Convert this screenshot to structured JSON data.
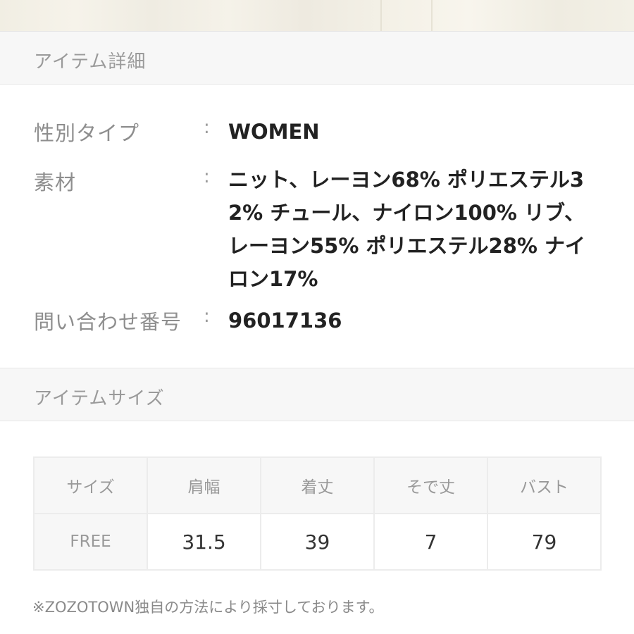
{
  "item_details": {
    "header": "アイテム詳細",
    "rows": [
      {
        "label": "性別タイプ",
        "colon": ":",
        "value": "WOMEN"
      },
      {
        "label": "素材",
        "colon": ":",
        "value": "ニット、レーヨン68% ポリエステル32% チュール、ナイロン100% リブ、レーヨン55% ポリエステル28% ナイロン17%"
      },
      {
        "label": "問い合わせ番号",
        "colon": ":",
        "value": "96017136"
      }
    ]
  },
  "item_size": {
    "header": "アイテムサイズ",
    "columns": [
      "サイズ",
      "肩幅",
      "着丈",
      "そで丈",
      "バスト"
    ],
    "rows": [
      {
        "size": "FREE",
        "values": [
          "31.5",
          "39",
          "7",
          "79"
        ]
      }
    ]
  },
  "footnote": "※ZOZOTOWN独自の方法により採寸しております。"
}
